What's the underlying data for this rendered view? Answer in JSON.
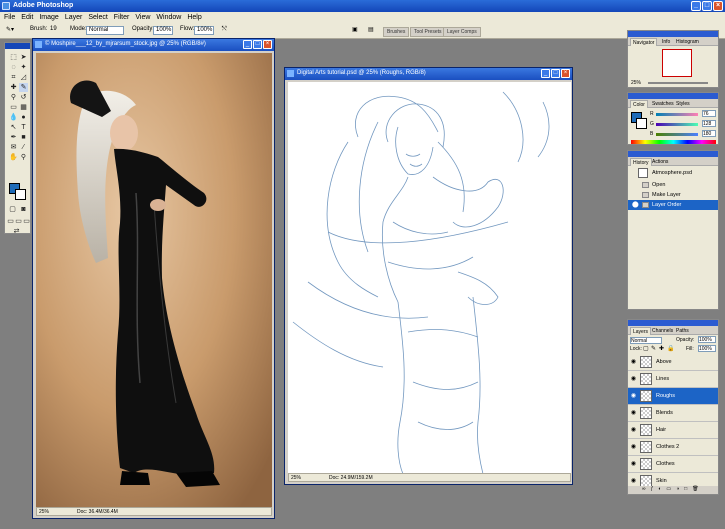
{
  "app": {
    "title": "Adobe Photoshop"
  },
  "menu": [
    "File",
    "Edit",
    "Image",
    "Layer",
    "Select",
    "Filter",
    "View",
    "Window",
    "Help"
  ],
  "options": {
    "brush_label": "Brush:",
    "brush_size": "19",
    "mode_label": "Mode:",
    "mode_value": "Normal",
    "opacity_label": "Opacity:",
    "opacity_value": "100%",
    "flow_label": "Flow:",
    "flow_value": "100%"
  },
  "palette_well_tabs": [
    "Brushes",
    "Tool Presets",
    "Layer Comps"
  ],
  "doc1": {
    "title": "© Moshpire___12_by_mjrarsum_stock.jpg @ 25% (RGB/8#)",
    "zoom": "25%",
    "docsize": "Doc: 36.4M/36.4M"
  },
  "doc2": {
    "title": "Digital Arts tutorial.psd @ 25% (Roughs, RGB/8)",
    "zoom": "25%",
    "docsize": "Doc: 24.9M/159.2M"
  },
  "navigator": {
    "tabs": [
      "Navigator",
      "Info",
      "Histogram"
    ],
    "zoom": "25%"
  },
  "color": {
    "tabs": [
      "Color",
      "Swatches",
      "Styles"
    ],
    "r": "76",
    "g": "128",
    "b": "180",
    "fg_color": "#1e6bb8"
  },
  "history": {
    "tabs": [
      "History",
      "Actions"
    ],
    "snapshot": "Atmosphere.psd",
    "items": [
      "Open",
      "Make Layer",
      "Layer Order"
    ],
    "selected_index": 2
  },
  "layers": {
    "tabs": [
      "Layers",
      "Channels",
      "Paths"
    ],
    "blend_mode": "Normal",
    "opacity_label": "Opacity:",
    "opacity_value": "100%",
    "lock_label": "Lock:",
    "fill_label": "Fill:",
    "fill_value": "100%",
    "items": [
      "Above",
      "Lines",
      "Roughs",
      "Blends",
      "Hair",
      "Clothes 2",
      "Clothes",
      "Skin"
    ],
    "selected": "Roughs"
  }
}
